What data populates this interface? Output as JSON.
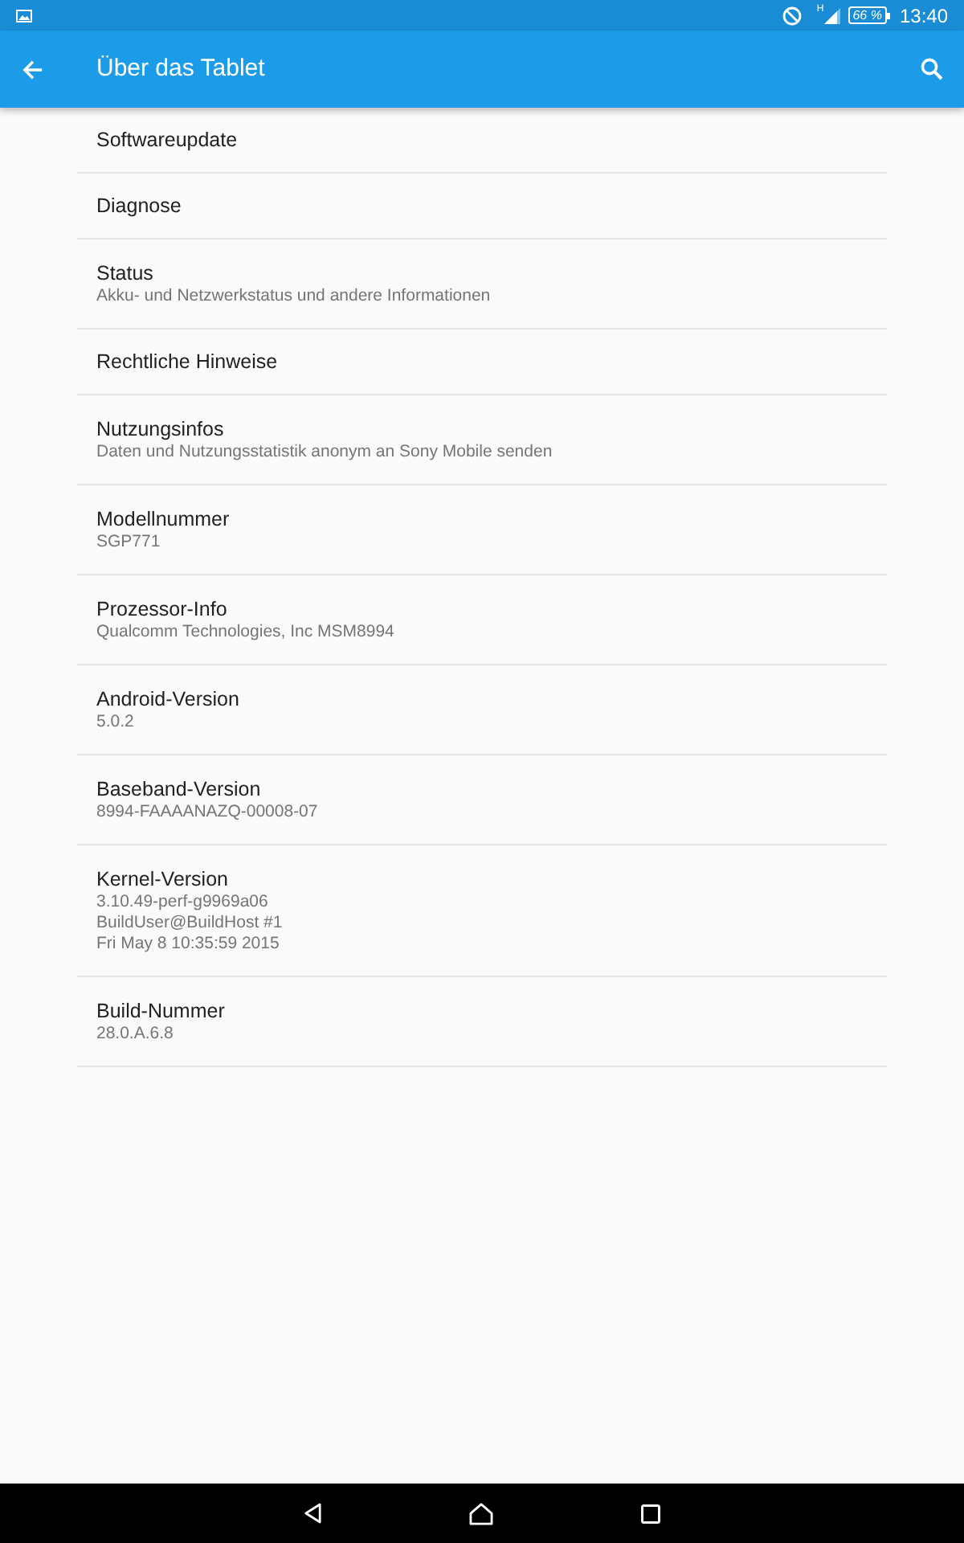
{
  "status_bar": {
    "network_type": "H",
    "battery": "66 %",
    "time": "13:40"
  },
  "app_bar": {
    "title": "Über das Tablet"
  },
  "items": [
    {
      "title": "Softwareupdate"
    },
    {
      "title": "Diagnose"
    },
    {
      "title": "Status",
      "summary": [
        "Akku- und Netzwerkstatus und andere Informationen"
      ]
    },
    {
      "title": "Rechtliche Hinweise"
    },
    {
      "title": "Nutzungsinfos",
      "summary": [
        "Daten und Nutzungsstatistik anonym an Sony Mobile senden"
      ]
    },
    {
      "title": "Modellnummer",
      "summary": [
        "SGP771"
      ]
    },
    {
      "title": "Prozessor-Info",
      "summary": [
        "Qualcomm Technologies, Inc MSM8994"
      ]
    },
    {
      "title": "Android-Version",
      "summary": [
        "5.0.2"
      ]
    },
    {
      "title": "Baseband-Version",
      "summary": [
        "8994-FAAAANAZQ-00008-07"
      ]
    },
    {
      "title": "Kernel-Version",
      "summary": [
        "3.10.49-perf-g9969a06",
        "BuildUser@BuildHost #1",
        "Fri May 8 10:35:59 2015"
      ]
    },
    {
      "title": "Build-Nummer",
      "summary": [
        "28.0.A.6.8"
      ]
    }
  ]
}
